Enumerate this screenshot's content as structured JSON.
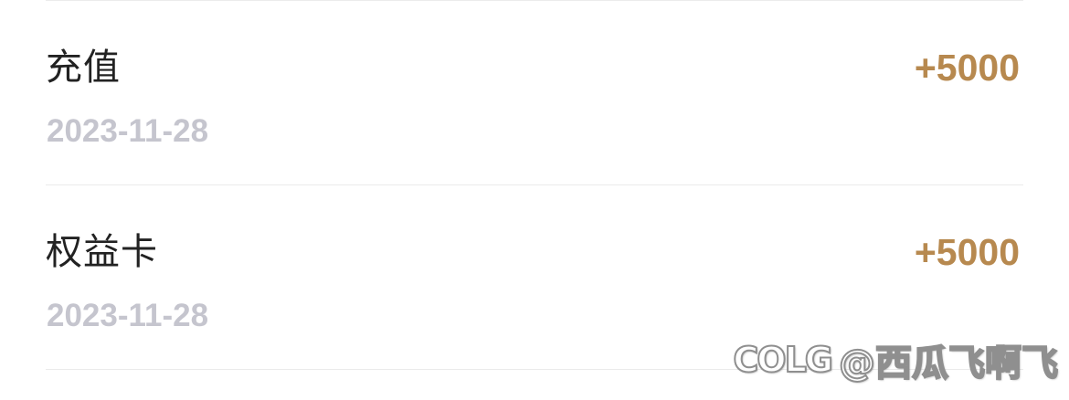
{
  "transactions": [
    {
      "title": "充值",
      "date": "2023-11-28",
      "amount": "+5000"
    },
    {
      "title": "权益卡",
      "date": "2023-11-28",
      "amount": "+5000"
    }
  ],
  "watermark": {
    "logo": "COLG",
    "handle": "@西瓜飞啊飞"
  },
  "colors": {
    "amount": "#b7894f",
    "date": "#c5c5ce",
    "title": "#222222",
    "divider": "#ebebeb"
  }
}
